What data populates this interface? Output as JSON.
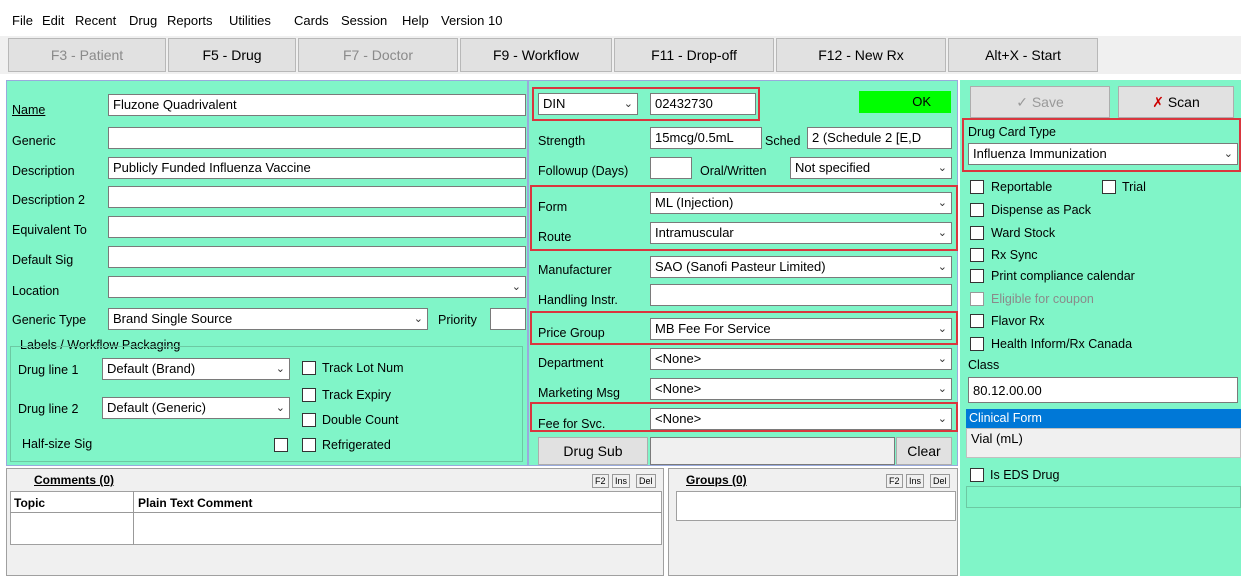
{
  "menu": [
    "File",
    "Edit",
    "Recent",
    "Drug",
    "Reports",
    "Utilities",
    "Cards",
    "Session",
    "Help",
    "Version 10"
  ],
  "tabs": [
    {
      "label": "F3 - Patient",
      "disabled": true
    },
    {
      "label": "F5 - Drug",
      "disabled": false
    },
    {
      "label": "F7 - Doctor",
      "disabled": true
    },
    {
      "label": "F9 - Workflow",
      "disabled": false
    },
    {
      "label": "F11 - Drop-off",
      "disabled": false
    },
    {
      "label": "F12 - New Rx",
      "disabled": false
    },
    {
      "label": "Alt+X - Start",
      "disabled": false
    }
  ],
  "left": {
    "name_label": "Name",
    "name_value": "Fluzone Quadrivalent",
    "generic_label": "Generic",
    "generic_value": "",
    "description_label": "Description",
    "description_value": "Publicly Funded Influenza Vaccine",
    "description2_label": "Description 2",
    "equivalent_label": "Equivalent To",
    "default_sig_label": "Default Sig",
    "location_label": "Location",
    "generic_type_label": "Generic Type",
    "generic_type_value": "Brand Single Source",
    "priority_label": "Priority",
    "labels_group_title": "Labels / Workflow Packaging",
    "drug_line1_label": "Drug line 1",
    "drug_line1_value": "Default (Brand)",
    "drug_line2_label": "Drug line 2",
    "drug_line2_value": "Default (Generic)",
    "half_size_sig_label": "Half-size Sig",
    "track_lot_label": "Track Lot Num",
    "track_expiry_label": "Track Expiry",
    "double_count_label": "Double Count",
    "refrigerated_label": "Refrigerated"
  },
  "middle": {
    "din_type": "DIN",
    "din_value": "02432730",
    "ok_label": "OK",
    "strength_label": "Strength",
    "strength_value": "15mcg/0.5mL",
    "sched_label": "Sched",
    "sched_value": "2 (Schedule 2 [E,D",
    "followup_label": "Followup (Days)",
    "oral_written_label": "Oral/Written",
    "oral_written_value": "Not specified",
    "form_label": "Form",
    "form_value": "ML (Injection)",
    "route_label": "Route",
    "route_value": "Intramuscular",
    "manufacturer_label": "Manufacturer",
    "manufacturer_value": "SAO (Sanofi  Pasteur Limited)",
    "handling_label": "Handling Instr.",
    "price_group_label": "Price Group",
    "price_group_value": "MB Fee For Service",
    "department_label": "Department",
    "department_value": "<None>",
    "marketing_label": "Marketing Msg",
    "marketing_value": "<None>",
    "fee_label": "Fee for Svc.",
    "fee_value": "<None>",
    "drug_sub_label": "Drug Sub",
    "clear_label": "Clear"
  },
  "right": {
    "save_label": "Save",
    "scan_label": "Scan",
    "card_type_label": "Drug Card Type",
    "card_type_value": "Influenza Immunization",
    "reportable_label": "Reportable",
    "trial_label": "Trial",
    "dispense_pack_label": "Dispense as Pack",
    "ward_stock_label": "Ward Stock",
    "rx_sync_label": "Rx Sync",
    "print_calendar_label": "Print compliance calendar",
    "coupon_label": "Eligible for coupon",
    "flavor_label": "Flavor Rx",
    "health_inform_label": "Health Inform/Rx Canada",
    "class_label": "Class",
    "class_value": "80.12.00.00",
    "clinical_form_label": "Clinical Form",
    "clinical_form_value": "Vial (mL)",
    "eds_label": "Is EDS Drug"
  },
  "comments": {
    "title": "Comments (0)",
    "f2": "F2",
    "ins": "Ins",
    "del": "Del",
    "col_topic": "Topic",
    "col_plain": "Plain Text Comment"
  },
  "groups": {
    "title": "Groups (0)",
    "f2": "F2",
    "ins": "Ins",
    "del": "Del"
  },
  "colors": {
    "panel_green": "#80f5c8",
    "ok_green": "#00ff00",
    "highlight_red": "#d9363e"
  }
}
